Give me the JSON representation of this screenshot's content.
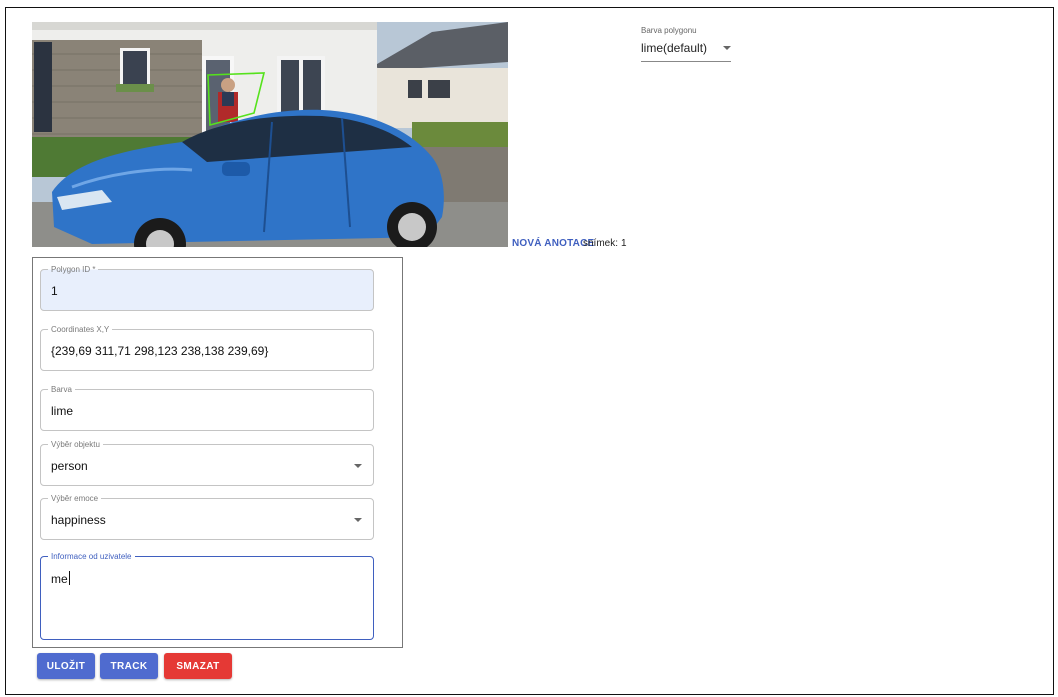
{
  "colors": {
    "accent": "#4f6bcf",
    "danger": "#e53935",
    "polygon": "#55e21c",
    "focus": "#3f5fbf"
  },
  "toolbar": {
    "new_annotation_label": "NOVÁ ANOTACE",
    "frame_label": "snímek:",
    "frame_value": "1"
  },
  "polygon_color_select": {
    "label": "Barva polygonu",
    "value": "lime(default)"
  },
  "form": {
    "polygon_id": {
      "label": "Polygon ID *",
      "value": "1"
    },
    "coordinates": {
      "label": "Coordinates X,Y",
      "value": "{239,69 311,71 298,123 238,138 239,69}"
    },
    "color": {
      "label": "Barva",
      "value": "lime"
    },
    "object": {
      "label": "Výběr objektu",
      "value": "person"
    },
    "emotion": {
      "label": "Výběr emoce",
      "value": "happiness"
    },
    "user_info": {
      "label": "Informace od uzivatele",
      "value": "me"
    }
  },
  "buttons": {
    "save": "ULOŽIT",
    "track": "TRACK",
    "delete": "SMAZAT"
  }
}
